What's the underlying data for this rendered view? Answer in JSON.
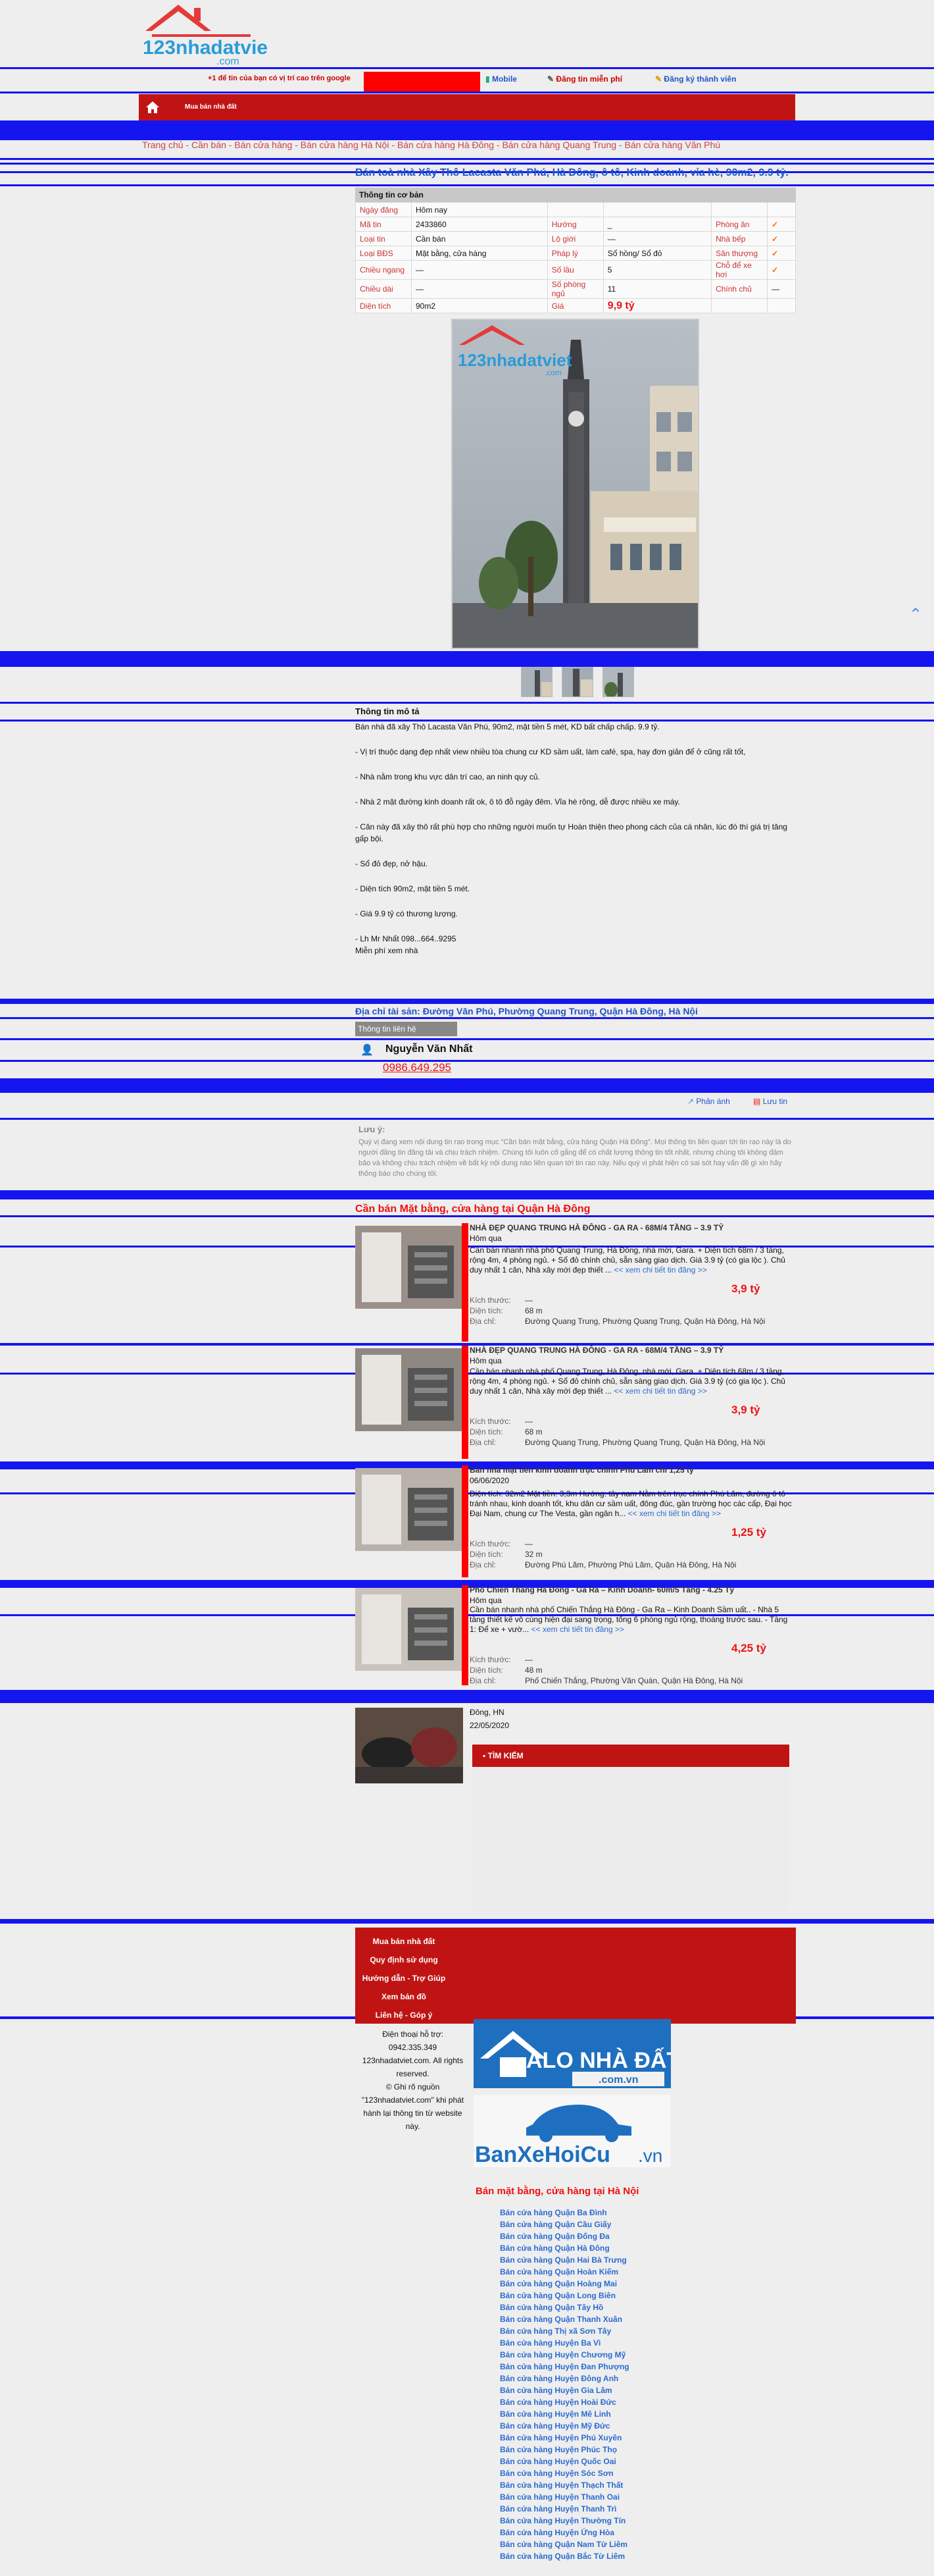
{
  "header": {
    "logo_text": "123nhadatviet",
    "logo_sub": ".com",
    "promo": "+1 để tin của bạn có vị trí cao trên google",
    "mobile": "Mobile",
    "register_free": "Đăng tin miễn phí",
    "register_member": "Đăng ký thành viên",
    "menu_text": "Mua bán nhà đất"
  },
  "breadcrumb": "Trang chủ - Cần bán - Bán cửa hàng - Bán cửa hàng Hà Nội - Bán cửa hàng Hà Đông - Bán cửa hàng Quang Trung - Bán cửa hàng Văn Phú",
  "title": "Bán toà nhà Xây Thô Lacasta Văn Phú, Hà Đông, ô tô, Kinh doanh, vỉa hè, 90m2, 9.9 tỷ.",
  "info": {
    "header": "Thông tin cơ bản",
    "rows": [
      [
        "Ngày đăng",
        "Hôm nay",
        "",
        "",
        "",
        ""
      ],
      [
        "Mã tin",
        "2433860",
        "Hướng",
        "_",
        "Phòng ăn",
        "✓"
      ],
      [
        "Loại tin",
        "Cần bán",
        "Lộ giới",
        "—",
        "Nhà bếp",
        "✓"
      ],
      [
        "Loại BĐS",
        "Mặt bằng, cửa hàng",
        "Pháp lý",
        "Sổ hồng/ Sổ đỏ",
        "Sân thượng",
        "✓"
      ],
      [
        "Chiều ngang",
        "—",
        "Số lầu",
        "5",
        "Chỗ để xe hơi",
        "✓"
      ],
      [
        "Chiều dài",
        "—",
        "Số phòng ngủ",
        "11",
        "Chính chủ",
        "—"
      ],
      [
        "Diện tích",
        "90m2",
        "Giá",
        "9,9 tỷ",
        "",
        ""
      ]
    ]
  },
  "desc": {
    "header": "Thông tin mô tả",
    "lines": [
      "Bán nhà đã xây Thô Lacasta Văn Phú, 90m2, mặt tiền 5 mét, KD bất chấp chấp. 9.9 tỷ.",
      "- Vị trí thuộc dạng đẹp nhất view nhiều tòa chung cư KD sầm uất, làm café, spa, hay đơn giản để ở cũng rất tốt,",
      "- Nhà nằm trong khu vực dân trí cao, an ninh quy củ.",
      "- Nhà 2 mặt đường kinh doanh rất ok, ô tô đỗ ngày đêm. Vỉa hè rộng, dễ được nhiều xe máy.",
      "- Căn này đã xây thô rất phù hợp cho những người muốn tự Hoàn thiện theo phong cách của cá nhân, lúc đó thì giá trị tăng gấp bội.",
      "- Sổ đỏ đẹp, nở hậu.",
      "- Diện tích 90m2, mặt tiền 5 mét.",
      "- Giá 9.9 tỷ có thương lượng.",
      "- Lh Mr Nhất 098...664..9295",
      "Miễn phí xem nhà"
    ]
  },
  "address": "Địa chỉ tài sản: Đường Văn Phú, Phường Quang Trung, Quận Hà Đông, Hà Nội",
  "contact": {
    "header": "Thông tin liên hệ",
    "name": "Nguyễn Văn Nhất",
    "phone": "0986.649.295"
  },
  "actions": {
    "share": "Phản ánh",
    "save": "Lưu tin"
  },
  "note": {
    "header": "Lưu ý:",
    "text": "Quý vị đang xem nội dung tin rao trong mục \"Cần bán mặt bằng, cửa hàng Quận Hà Đông\". Mọi thông tin liên quan tới tin rao này là do người đăng tin đăng tải và chịu trách nhiệm. Chúng tôi luôn cố gắng để có chất lượng thông tin tốt nhất, nhưng chúng tôi không đảm bảo và không chịu trách nhiệm về bất kỳ nội dung nào liên quan tới tin rao này. Nếu quý vị phát hiện có sai sót hay vấn đề gì xin hãy thông báo cho chúng tôi."
  },
  "related": {
    "header": "Cần bán Mặt bằng, cửa hàng tại Quận Hà Đông",
    "items": [
      {
        "title": "NHÀ ĐẸP QUANG TRUNG HÀ ĐÔNG - GA RA - 68M/4 TẦNG – 3.9 TỶ",
        "date": "Hôm qua",
        "summary": "Cần bán nhanh nhà phố Quang Trung, Hà Đông, nhà mới, Gara. + Diện tích 68m / 3 tầng, rộng 4m, 4 phòng ngủ. + Sổ đỏ chính chủ, sẵn sàng giao dịch. Giá 3.9 tỷ (có gia lộc ). Chủ duy nhất 1 căn, Nhà xây mới đẹp thiết ...",
        "more": "<< xem chi tiết tin đăng >>",
        "price": "3,9 tỷ",
        "size": "—",
        "area": "68 m",
        "addr": "Đường Quang Trung, Phường Quang Trung, Quận Hà Đông, Hà Nội"
      },
      {
        "title": "NHÀ ĐẸP QUANG TRUNG HÀ ĐÔNG - GA RA - 68M/4 TẦNG – 3.9 TỶ",
        "date": "Hôm qua",
        "summary": "Cần bán nhanh nhà phố Quang Trung, Hà Đông, nhà mới, Gara. + Diện tích 68m / 3 tầng, rộng 4m, 4 phòng ngủ. + Sổ đỏ chính chủ, sẵn sàng giao dịch. Giá 3.9 tỷ (có gia lộc ). Chủ duy nhất 1 căn, Nhà xây mới đẹp thiết ...",
        "more": "<< xem chi tiết tin đăng >>",
        "price": "3,9 tỷ",
        "size": "—",
        "area": "68 m",
        "addr": "Đường Quang Trung, Phường Quang Trung, Quận Hà Đông, Hà Nội"
      },
      {
        "title": "Bán nhà mặt tiền kinh doanh trục chính Phú Lãm chỉ 1,25 tỷ",
        "date": "06/06/2020",
        "summary": "Diện tích: 32m2 Mặt tiền: 3,3m Hướng: tây nam Nằm trên trục chính Phú Lãm, đường ô tô tránh nhau, kinh doanh tốt, khu dân cư sầm uất, đông đúc, gần trường học các cấp, Đại học Đại Nam, chung cư The Vesta, gần ngân h...",
        "more": "<< xem chi tiết tin đăng >>",
        "price": "1,25 tỷ",
        "size": "—",
        "area": "32 m",
        "addr": "Đường Phú Lãm, Phường Phú Lãm, Quận Hà Đông, Hà Nội"
      },
      {
        "title": "Phố Chiến Thắng Hà Đông - Ga Ra – Kinh Doanh- 60m/5 Tầng - 4.25 Tỷ",
        "date": "Hôm qua",
        "summary": "Cần bán nhanh nhà phố Chiến Thắng Hà Đông - Ga Ra – Kinh Doanh Sầm uất.. - Nhà 5 tầng thiết kế vô cùng hiện đại sang trọng, tổng 6 phòng ngủ rộng, thoáng trước sau. - Tầng 1: Để xe + vườ...",
        "more": "<< xem chi tiết tin đăng >>",
        "price": "4,25 tỷ",
        "size": "—",
        "area": "48 m",
        "addr": "Phố Chiến Thắng, Phường Văn Quán, Quận Hà Đông, Hà Nội"
      }
    ],
    "last": {
      "loc": "Đông, HN",
      "date": "22/05/2020"
    },
    "labels": {
      "size": "Kích thước:",
      "area": "Diện tích:",
      "addr": "Địa chỉ:"
    }
  },
  "search": {
    "label": "TÌM KIẾM"
  },
  "footer": {
    "links": [
      "Mua bán nhà đất",
      "Quy định sử dụng",
      "Hướng dẫn - Trợ Giúp",
      "Xem bản đồ",
      "Liên hệ - Góp ý"
    ],
    "copy": [
      "Điện thoại hỗ trợ:",
      "0942.335.349",
      "123nhadatviet.com. All rights reserved.",
      "© Ghi rõ nguồn \"123nhadatviet.com\" khi phát hành lại thông tin từ website này."
    ],
    "banner1_top": "ALO NHÀ ĐẤT",
    "banner1_sub": ".com.vn",
    "banner2_main": "BanXeHoiCu",
    "banner2_ext": ".vn"
  },
  "categories": {
    "header": "Bán mặt bằng, cửa hàng tại Hà Nội",
    "items": [
      "Bán cửa hàng Quận Ba Đình",
      "Bán cửa hàng Quận Cầu Giấy",
      "Bán cửa hàng Quận Đống Đa",
      "Bán cửa hàng Quận Hà Đông",
      "Bán cửa hàng Quận Hai Bà Trưng",
      "Bán cửa hàng Quận Hoàn Kiếm",
      "Bán cửa hàng Quận Hoàng Mai",
      "Bán cửa hàng Quận Long Biên",
      "Bán cửa hàng Quận Tây Hồ",
      "Bán cửa hàng Quận Thanh Xuân",
      "Bán cửa hàng Thị xã Sơn Tây",
      "Bán cửa hàng Huyện Ba Vì",
      "Bán cửa hàng Huyện Chương Mỹ",
      "Bán cửa hàng Huyện Đan Phượng",
      "Bán cửa hàng Huyện Đông Anh",
      "Bán cửa hàng Huyện Gia Lâm",
      "Bán cửa hàng Huyện Hoài Đức",
      "Bán cửa hàng Huyện Mê Linh",
      "Bán cửa hàng Huyện Mỹ Đức",
      "Bán cửa hàng Huyện Phú Xuyên",
      "Bán cửa hàng Huyện Phúc Thọ",
      "Bán cửa hàng Huyện Quốc Oai",
      "Bán cửa hàng Huyện Sóc Sơn",
      "Bán cửa hàng Huyện Thạch Thất",
      "Bán cửa hàng Huyện Thanh Oai",
      "Bán cửa hàng Huyện Thanh Trì",
      "Bán cửa hàng Huyện Thường Tín",
      "Bán cửa hàng Huyện Ứng Hòa",
      "Bán cửa hàng Quận Nam Từ Liêm",
      "Bán cửa hàng Quận Bắc Từ Liêm"
    ]
  }
}
